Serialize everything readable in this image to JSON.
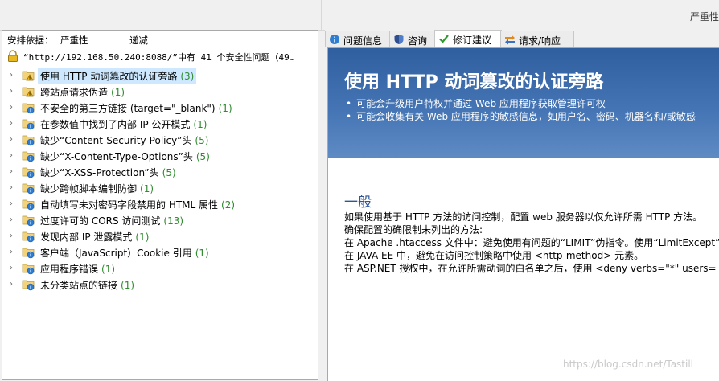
{
  "topbar": {
    "right_label": "严重性"
  },
  "sort": {
    "label": "安排依据：",
    "value": "严重性",
    "direction": "递减"
  },
  "summary": {
    "text": "“http://192.168.50.240:8088/”中有 41 个安全性问题（49…"
  },
  "issues": [
    {
      "label": "使用 HTTP 动词篡改的认证旁路",
      "count": "(3)",
      "icon": "folder-warning-icon"
    },
    {
      "label": "跨站点请求伪造",
      "count": "(1)",
      "icon": "folder-warning-icon"
    },
    {
      "label": "不安全的第三方链接 (target=\"_blank\")",
      "count": "(1)",
      "icon": "folder-info-icon"
    },
    {
      "label": "在参数值中找到了内部 IP 公开模式",
      "count": "(1)",
      "icon": "folder-info-icon"
    },
    {
      "label": "缺少“Content-Security-Policy”头",
      "count": "(5)",
      "icon": "folder-info-icon"
    },
    {
      "label": "缺少“X-Content-Type-Options”头",
      "count": "(5)",
      "icon": "folder-info-icon"
    },
    {
      "label": "缺少“X-XSS-Protection”头",
      "count": "(5)",
      "icon": "folder-info-icon"
    },
    {
      "label": "缺少跨帧脚本编制防御",
      "count": "(1)",
      "icon": "folder-info-icon"
    },
    {
      "label": "自动填写未对密码字段禁用的 HTML 属性",
      "count": "(2)",
      "icon": "folder-info-icon"
    },
    {
      "label": "过度许可的 CORS 访问测试",
      "count": "(13)",
      "icon": "folder-info-icon"
    },
    {
      "label": "发现内部 IP 泄露模式",
      "count": "(1)",
      "icon": "folder-info-icon"
    },
    {
      "label": "客户端（JavaScript）Cookie 引用",
      "count": "(1)",
      "icon": "folder-info-icon"
    },
    {
      "label": "应用程序错误",
      "count": "(1)",
      "icon": "folder-info-icon"
    },
    {
      "label": "未分类站点的链接",
      "count": "(1)",
      "icon": "folder-info-icon"
    }
  ],
  "tabs": [
    {
      "label": "问题信息",
      "icon": "info-icon"
    },
    {
      "label": "咨询",
      "icon": "shield-icon"
    },
    {
      "label": "修订建议",
      "icon": "checkmark-icon"
    },
    {
      "label": "请求/响应",
      "icon": "arrows-icon"
    }
  ],
  "detail": {
    "title": "使用 HTTP 动词篡改的认证旁路",
    "bullets": [
      "可能会升级用户特权并通过 Web 应用程序获取管理许可权",
      "可能会收集有关 Web 应用程序的敏感信息，如用户名、密码、机器名和/或敏感"
    ],
    "section_title": "一般",
    "lines": [
      "如果使用基于 HTTP 方法的访问控制，配置 web 服务器以仅允许所需 HTTP 方法。",
      "确保配置的确限制未列出的方法:",
      "在 Apache .htaccess 文件中：避免使用有问题的“LIMIT”伪指令。使用“LimitExcept”",
      "在 JAVA EE 中，避免在访问控制策略中使用 <http-method> 元素。",
      "在 ASP.NET 授权中，在允许所需动词的白名单之后，使用 <deny verbs=\"*\" users="
    ]
  },
  "watermark": "https://blog.csdn.net/Tastill",
  "colors": {
    "banner": "#3c6aa8",
    "count": "#2e8b2e",
    "selected": "#cde8ff",
    "section_title": "#2f5597"
  }
}
